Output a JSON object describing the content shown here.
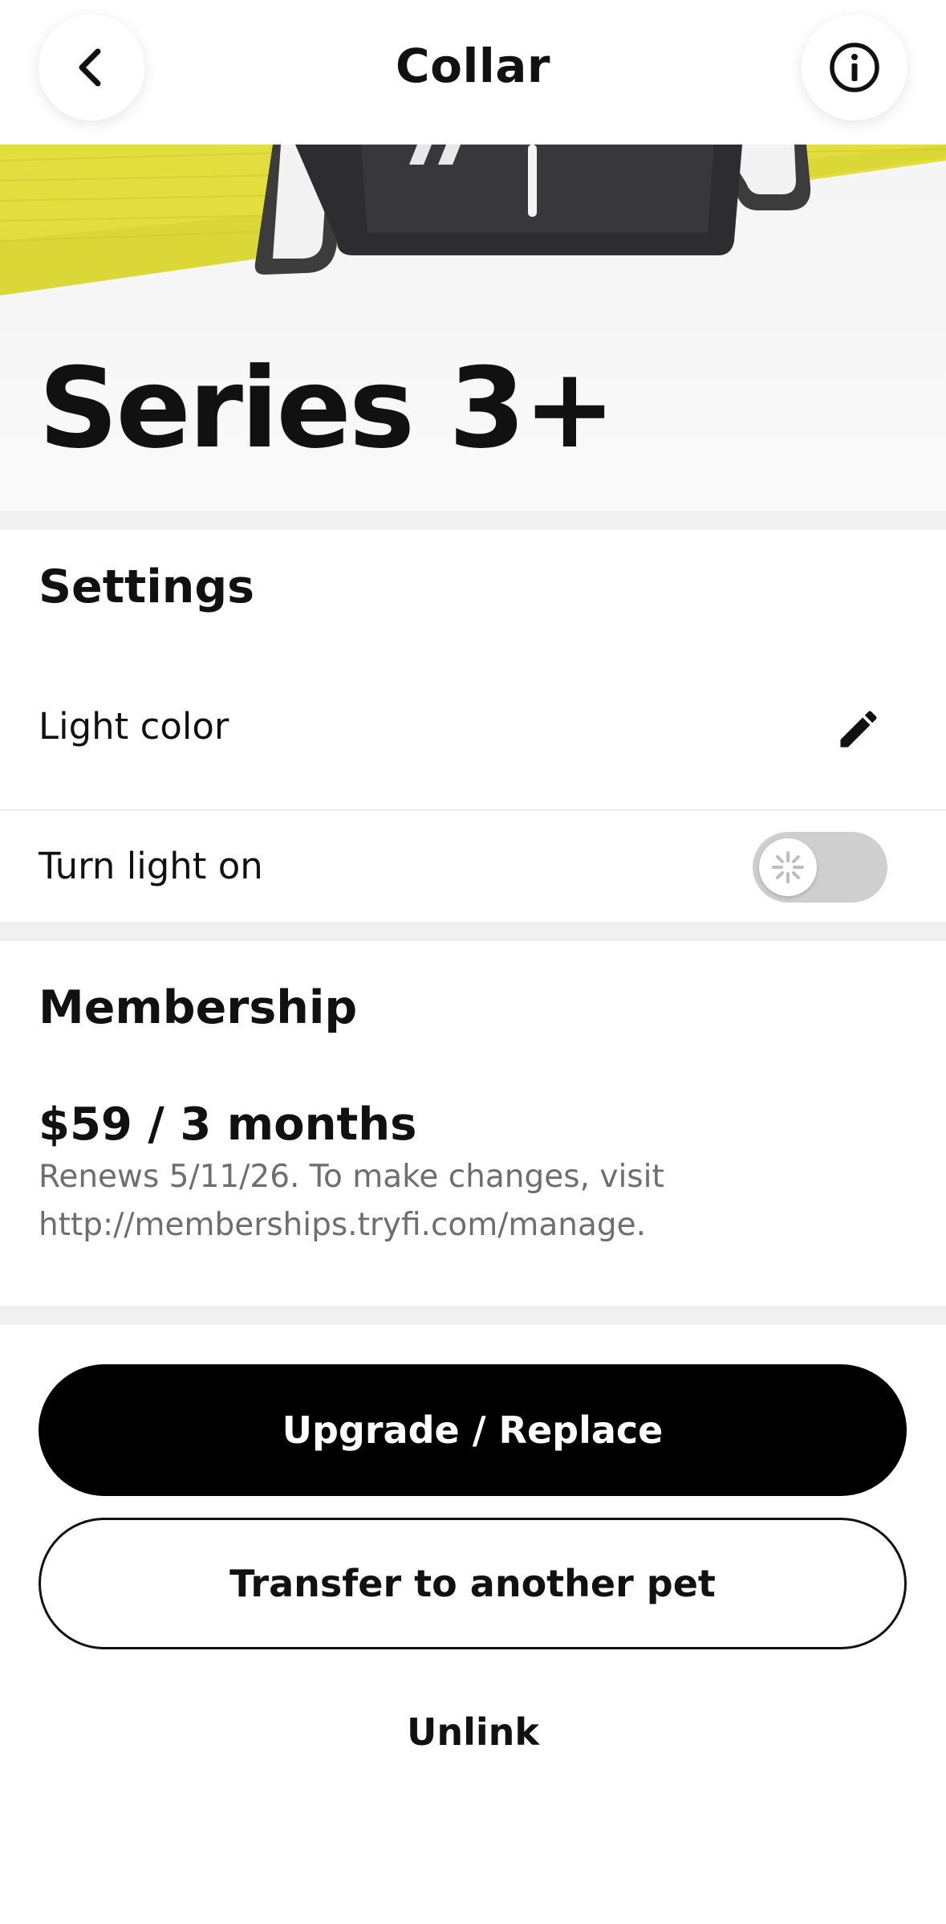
{
  "header": {
    "title": "Collar",
    "back_icon": "chevron-left-icon",
    "info_icon": "info-icon"
  },
  "hero": {
    "product_name": "Series 3+",
    "strap_color": "#e5e040"
  },
  "settings": {
    "title": "Settings",
    "light_color_label": "Light color",
    "edit_icon": "pencil-icon",
    "turn_light_on_label": "Turn light on",
    "turn_light_on_state": "off",
    "toggle_icon": "sparkle-icon"
  },
  "membership": {
    "title": "Membership",
    "price": "$59 / 3 months",
    "renewal_note": "Renews 5/11/26. To make changes, visit http://memberships.tryfi.com/manage."
  },
  "actions": {
    "upgrade_label": "Upgrade / Replace",
    "transfer_label": "Transfer to another pet",
    "unlink_label": "Unlink"
  },
  "colors": {
    "primary_button": "#000000",
    "section_gap": "#f0f0f0",
    "toggle_off": "#cfcfcf"
  }
}
